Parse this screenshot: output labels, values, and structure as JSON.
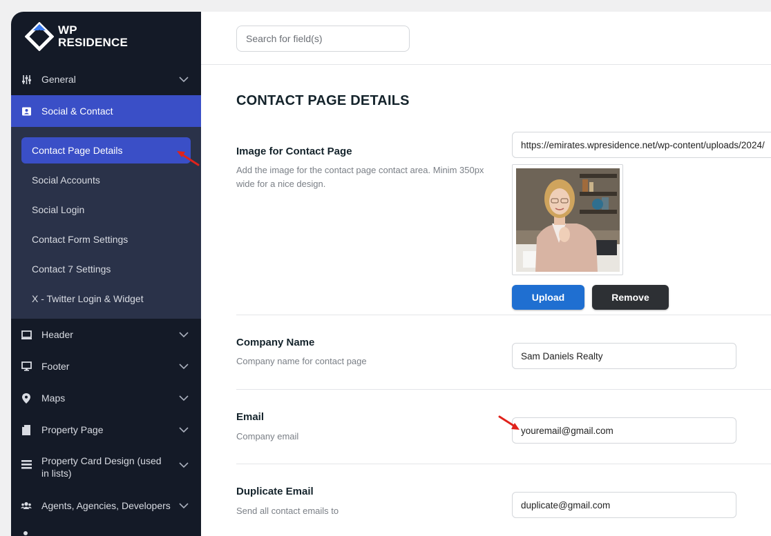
{
  "brand": {
    "line1": "WP",
    "line2": "RESIDENCE"
  },
  "sidebar": {
    "items": [
      {
        "label": "General",
        "icon": "sliders-icon"
      },
      {
        "label": "Social & Contact",
        "icon": "contact-card-icon"
      },
      {
        "label": "Header",
        "icon": "laptop-icon"
      },
      {
        "label": "Footer",
        "icon": "monitor-icon"
      },
      {
        "label": "Maps",
        "icon": "map-pin-icon"
      },
      {
        "label": "Property Page",
        "icon": "file-icon"
      },
      {
        "label": "Property Card Design (used in lists)",
        "icon": "list-icon"
      },
      {
        "label": "Agents, Agencies, Developers",
        "icon": "users-icon"
      }
    ],
    "submenu": [
      "Contact Page Details",
      "Social Accounts",
      "Social Login",
      "Contact Form Settings",
      "Contact 7 Settings",
      "X - Twitter Login & Widget"
    ]
  },
  "search": {
    "placeholder": "Search for field(s)"
  },
  "page": {
    "title": "CONTACT PAGE DETAILS"
  },
  "fields": {
    "image": {
      "title": "Image for Contact Page",
      "description": "Add the image for the contact page contact area. Minim 350px wide for a nice design.",
      "url": "https://emirates.wpresidence.net/wp-content/uploads/2024/",
      "upload_label": "Upload",
      "remove_label": "Remove"
    },
    "company": {
      "title": "Company Name",
      "description": "Company name for contact page",
      "value": "Sam Daniels Realty"
    },
    "email": {
      "title": "Email",
      "description": "Company email",
      "value": "youremail@gmail.com"
    },
    "duplicate_email": {
      "title": "Duplicate Email",
      "description": "Send all contact emails to",
      "value": "duplicate@gmail.com"
    }
  },
  "colors": {
    "sidebar_bg": "#141a27",
    "submenu_bg": "#2a3249",
    "accent": "#3a4fc7",
    "upload": "#1f6fd1",
    "remove": "#2d3034",
    "annotation_arrow": "#e0221b"
  }
}
